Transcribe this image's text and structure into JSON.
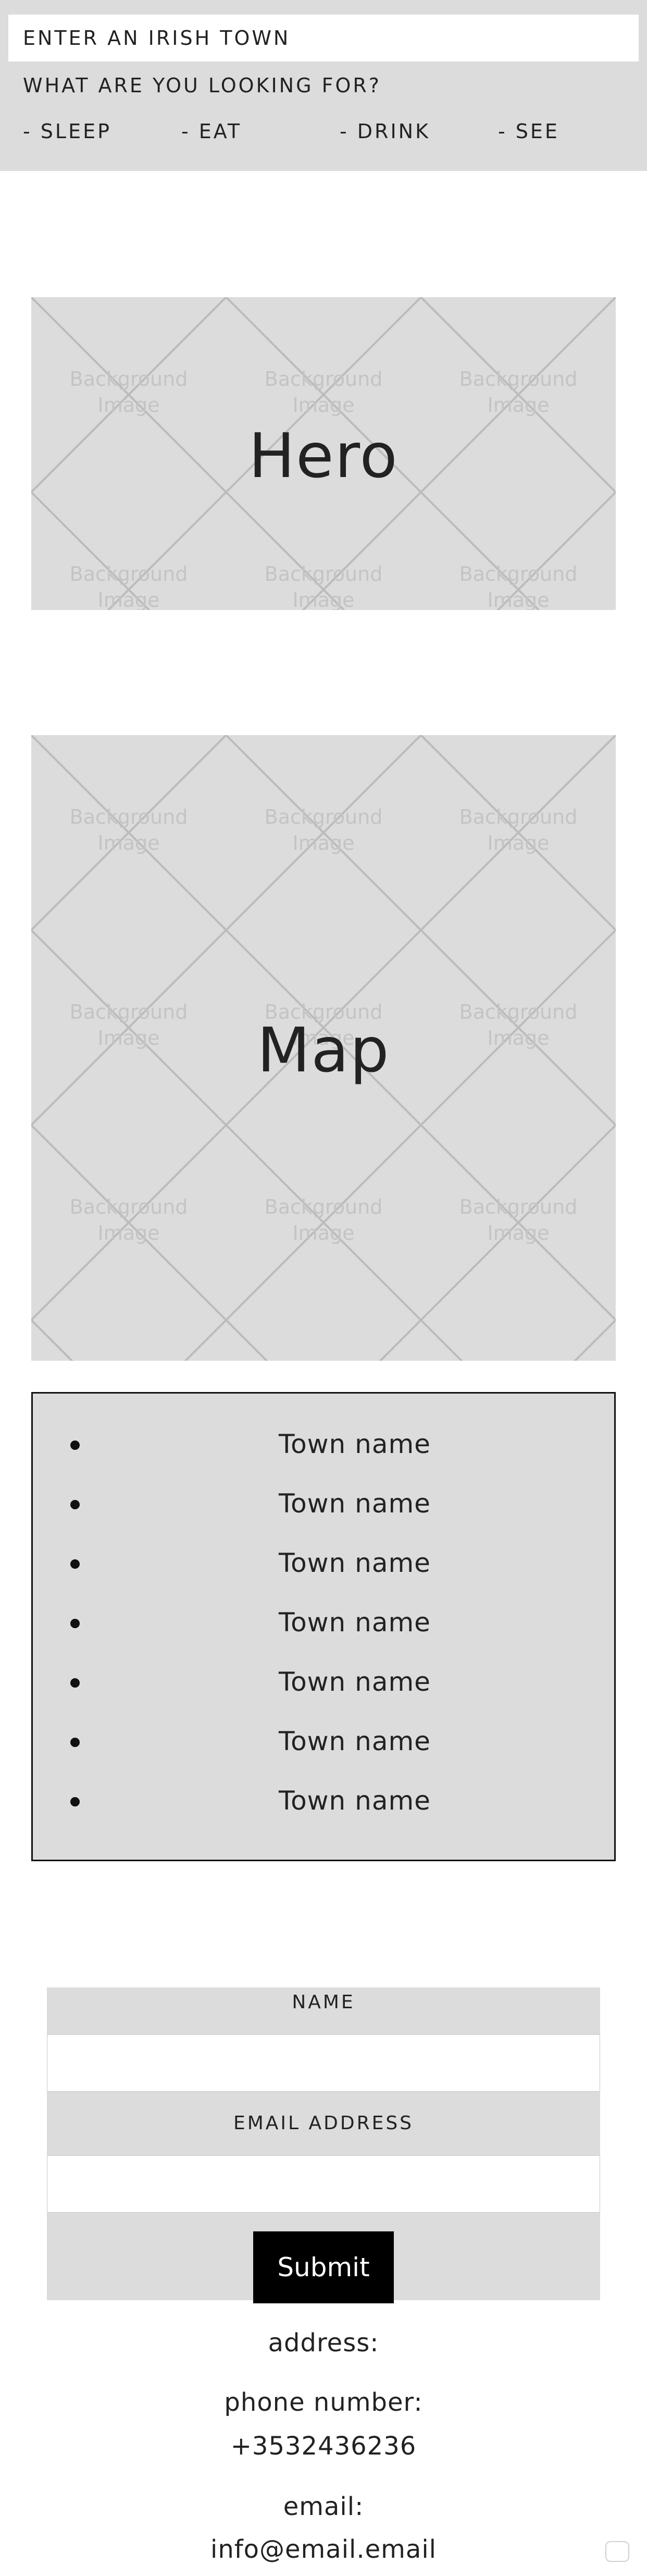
{
  "search": {
    "placeholder": "ENTER AN IRISH TOWN",
    "looking_label": "WHAT ARE YOU LOOKING FOR?",
    "categories": [
      "- SLEEP",
      "- EAT",
      "- DRINK",
      "- SEE"
    ]
  },
  "hero": {
    "title": "Hero",
    "bg_text": "Background Image"
  },
  "map": {
    "title": "Map"
  },
  "towns": [
    "Town name",
    "Town name",
    "Town name",
    "Town name",
    "Town name",
    "Town name",
    "Town name"
  ],
  "form": {
    "name_label": "NAME",
    "email_label": "EMAIL ADDRESS",
    "submit_label": "Submit"
  },
  "contact": {
    "address_label": "address:",
    "phone_label": "phone number:",
    "phone_value": "+3532436236",
    "email_label": "email:",
    "email_value": "info@email.email"
  },
  "colors": {
    "panel": "#dcdcdc",
    "pattern_line": "#bcbcbc",
    "pattern_text": "#c4c4c4",
    "button": "#000000"
  }
}
